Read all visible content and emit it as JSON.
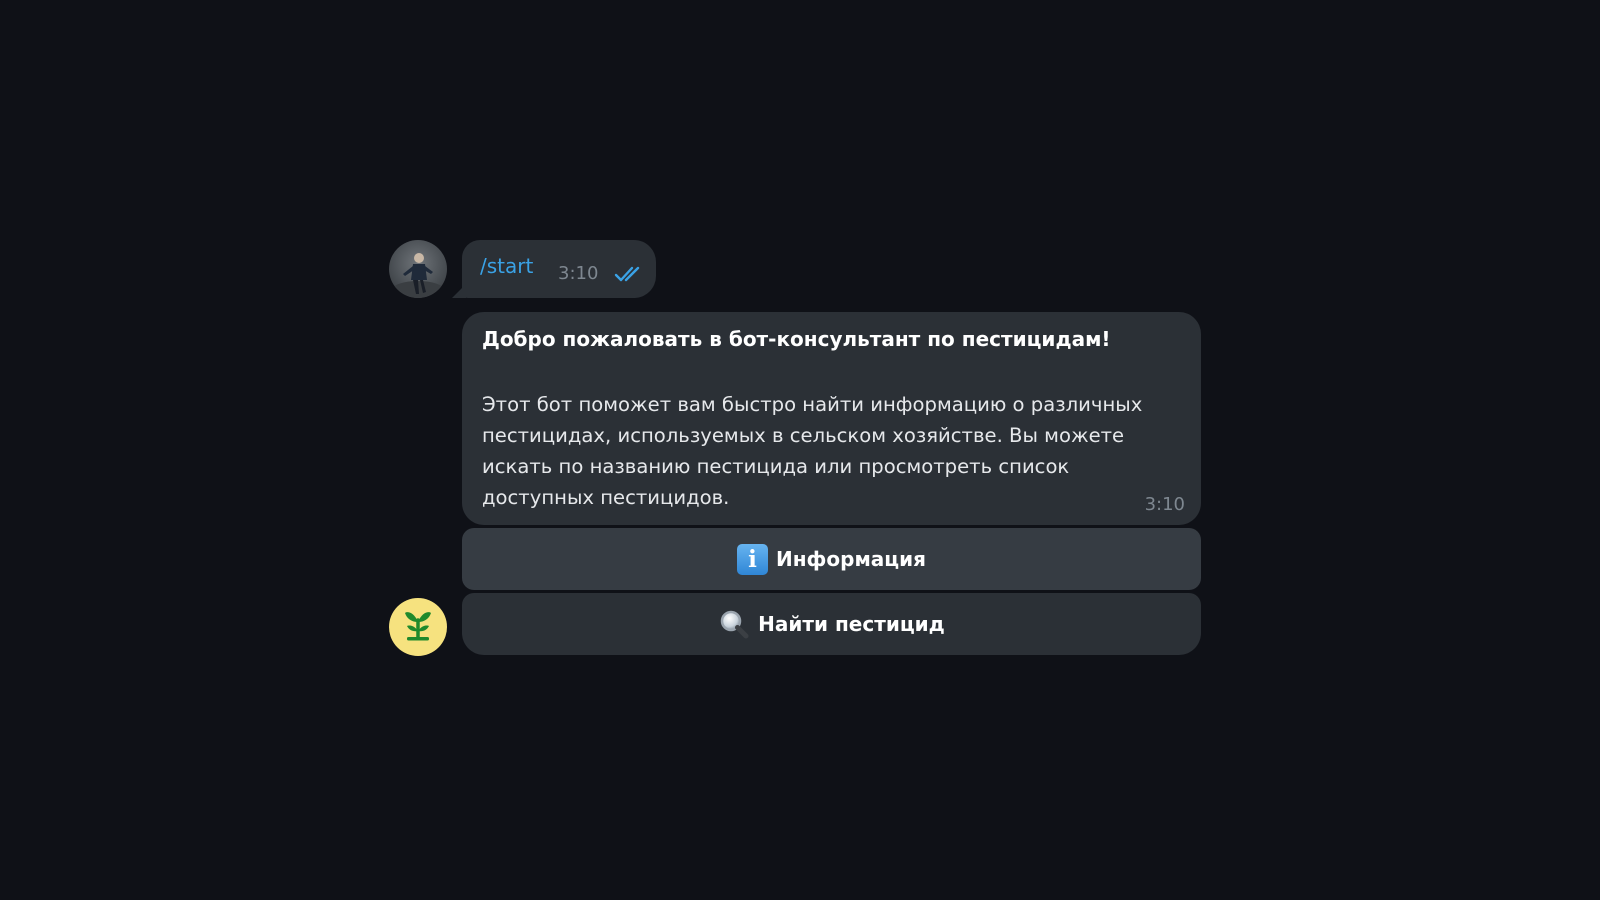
{
  "chat": {
    "outgoing": {
      "text": "/start",
      "time": "3:10",
      "status_icon": "double-check-icon",
      "link_color": "#3aa2e6"
    },
    "incoming": {
      "title": "Добро пожаловать в бот-консультант по пестицидам!",
      "body": "Этот бот поможет вам быстро найти информацию о различных пестицидах, используемых в сельском хозяйстве. Вы можете искать по названию пестицида или просмотреть список доступных пестицидов.",
      "time": "3:10"
    },
    "keyboard": {
      "buttons": [
        {
          "icon": "info-icon",
          "icon_glyph": "i",
          "label": "Информация"
        },
        {
          "icon": "magnifier-icon",
          "label": "Найти пестицид"
        }
      ]
    },
    "bot_avatar": {
      "icon": "plant-sprout-icon",
      "background": "#f6e27f",
      "icon_color": "#1f8a2c"
    }
  },
  "colors": {
    "background": "#0f1117",
    "bubble": "#2b3036",
    "button": "#363c43",
    "muted_text": "#7e8790"
  }
}
